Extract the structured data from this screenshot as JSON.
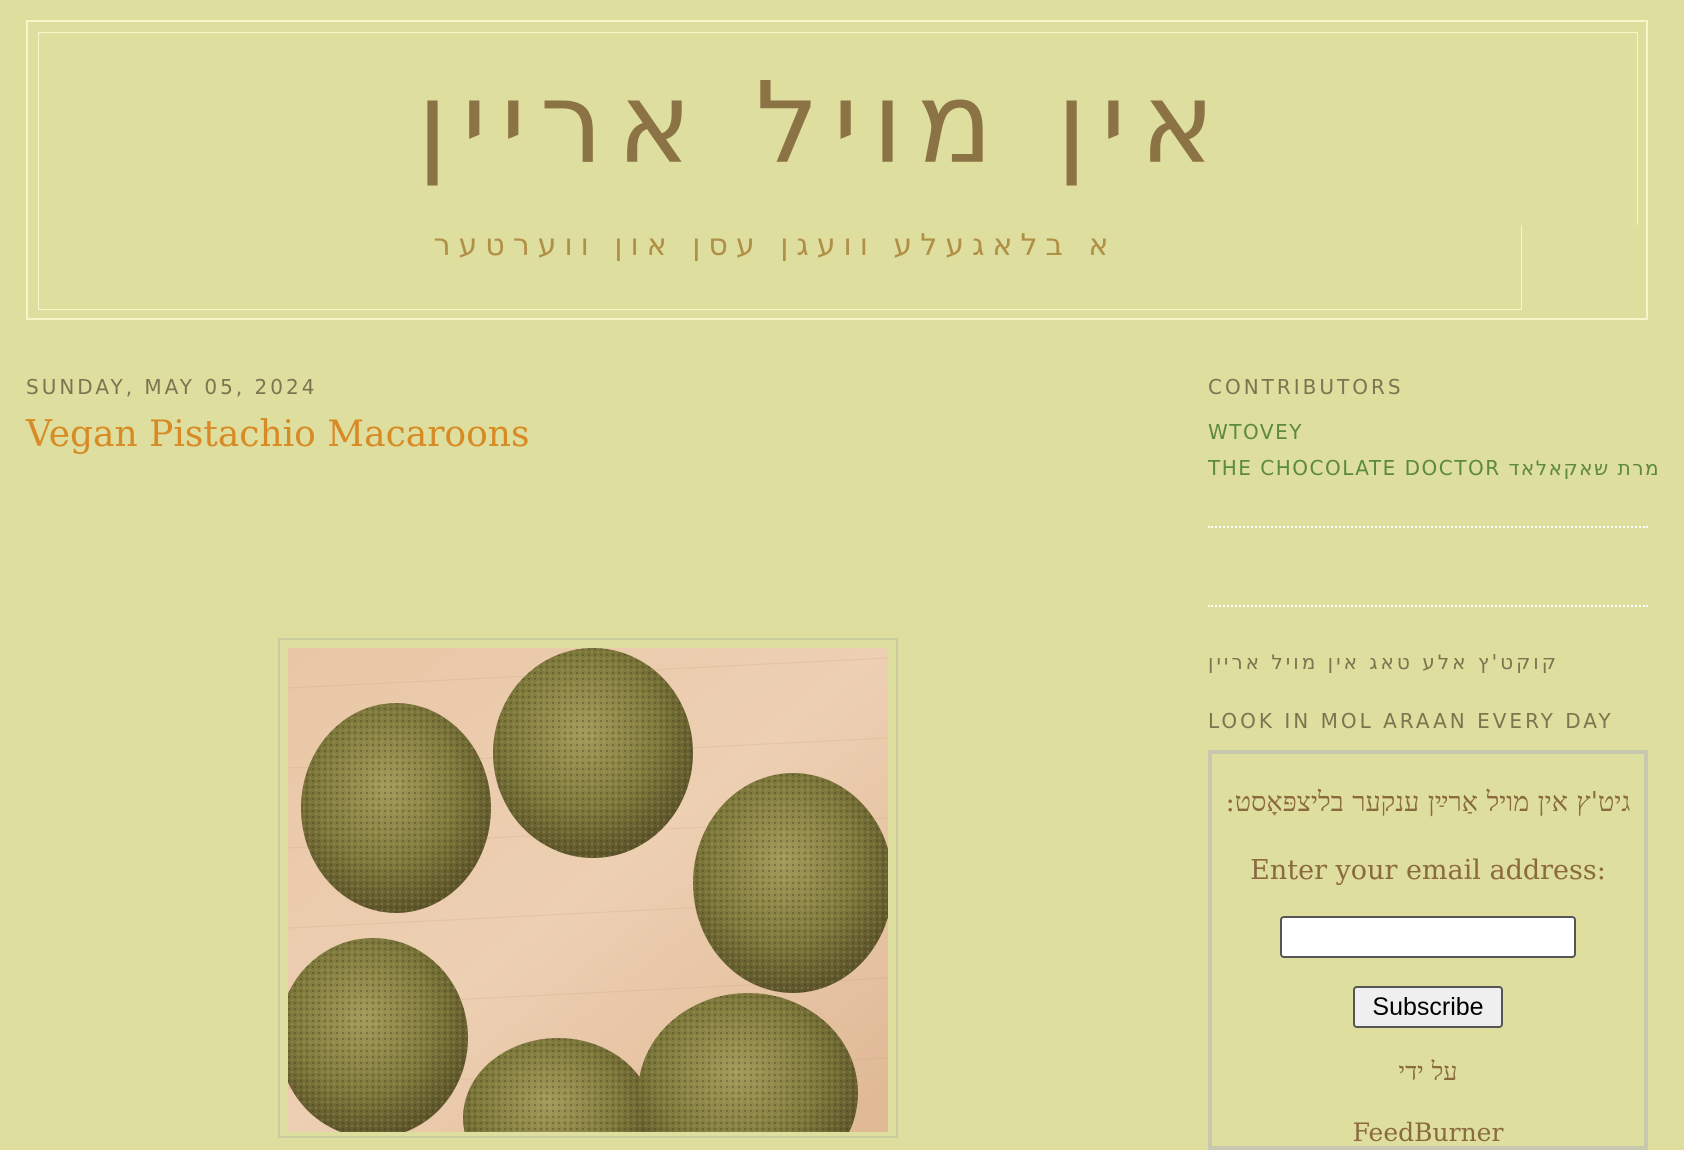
{
  "header": {
    "title": "אין מויל אריין",
    "description": "א בלאגעלע וועגן עסן און ווערטער"
  },
  "post": {
    "date": "Sunday, May 05, 2024",
    "title": "Vegan Pistachio Macaroons"
  },
  "sidebar": {
    "contributors_heading": "CONTRIBUTORS",
    "contributors": [
      {
        "name": "WTOVEY"
      },
      {
        "name": "THE CHOCOLATE DOCTOR מרת שאקאלאד"
      }
    ],
    "yiddish_heading": "קוקט'ץ אלע טאג אין מויל אריין",
    "look_heading": "LOOK IN MOL ARAAN EVERY DAY",
    "subscribe": {
      "heading": "גיט'ץ אין מויל אַרײַן ענקער בליצפּאָסט:",
      "label": "Enter your email address:",
      "input_value": "",
      "button": "Subscribe",
      "by": "על ידי",
      "brand": "FeedBurner"
    }
  },
  "colors": {
    "background": "#dede9e",
    "title": "#8b7345",
    "post_title": "#d88a24",
    "link": "#5d8a3c"
  }
}
